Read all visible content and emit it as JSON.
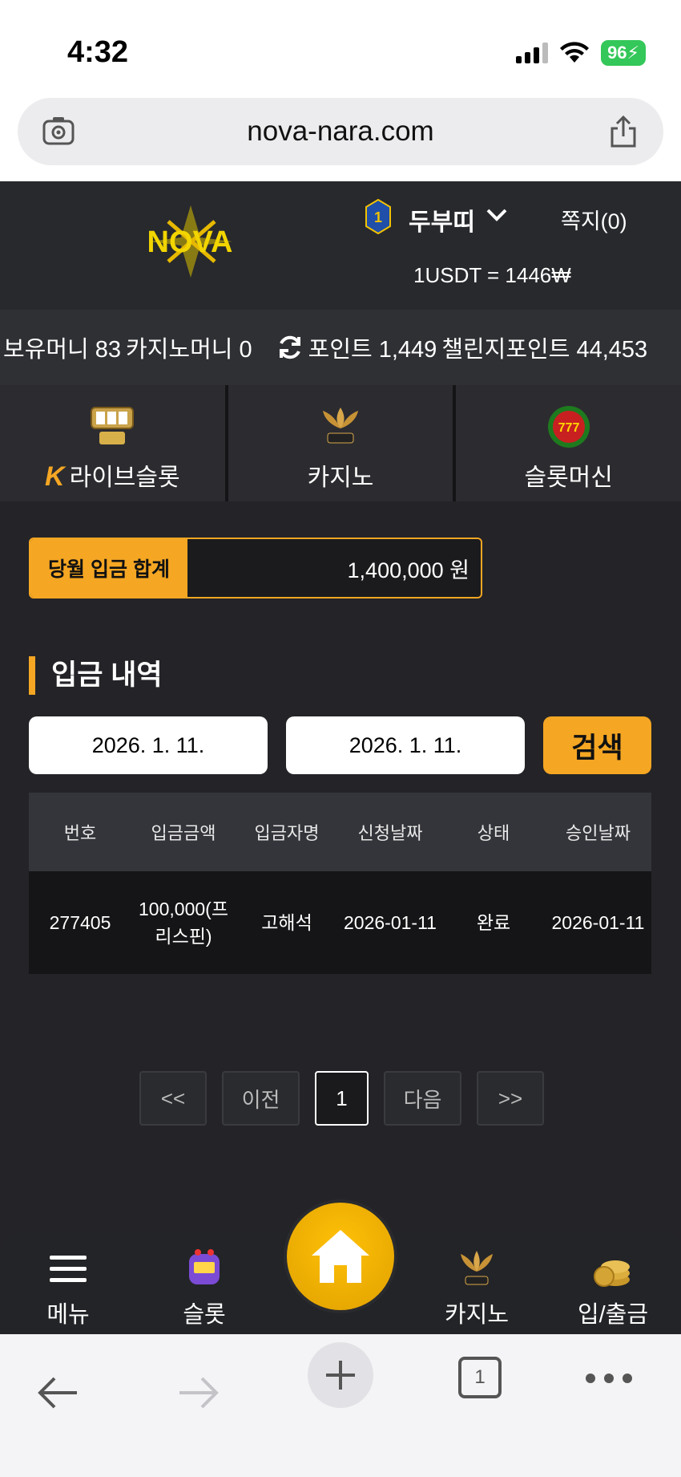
{
  "status_bar": {
    "time": "4:32",
    "battery": "96"
  },
  "browser": {
    "url": "nova-nara.com",
    "tab_count": "1"
  },
  "header": {
    "logo_text": "NOVA",
    "user_level": "1",
    "username": "두부띠",
    "messages": "쪽지(0)",
    "rate": "1USDT = 1446₩"
  },
  "balances": {
    "money": "보유머니 83",
    "casino_money": "카지노머니 0",
    "points": "포인트 1,449",
    "challenge_points": "챌린지포인트 44,453"
  },
  "game_tabs": [
    {
      "label": "라이브슬롯",
      "badge": "K"
    },
    {
      "label": "카지노"
    },
    {
      "label": "슬롯머신"
    }
  ],
  "monthly_total": {
    "label": "당월 입금 합계",
    "value": "1,400,000 원"
  },
  "section_title": "입금 내역",
  "filter": {
    "date_from": "2026. 1. 11.",
    "date_to": "2026. 1. 11.",
    "search_label": "검색"
  },
  "table": {
    "headers": [
      "번호",
      "입금금액",
      "입금자명",
      "신청날짜",
      "상태",
      "승인날짜"
    ],
    "rows": [
      [
        "277405",
        "100,000(프리스핀)",
        "고해석",
        "2026-01-11",
        "완료",
        "2026-01-11"
      ]
    ]
  },
  "pagination": {
    "first": "<<",
    "prev": "이전",
    "current": "1",
    "next": "다음",
    "last": ">>"
  },
  "app_nav": {
    "menu": "메뉴",
    "slot": "슬롯",
    "casino": "카지노",
    "deposit": "입/출금"
  },
  "colors": {
    "accent": "#f5a623",
    "bg": "#242428",
    "header": "#28292d"
  }
}
